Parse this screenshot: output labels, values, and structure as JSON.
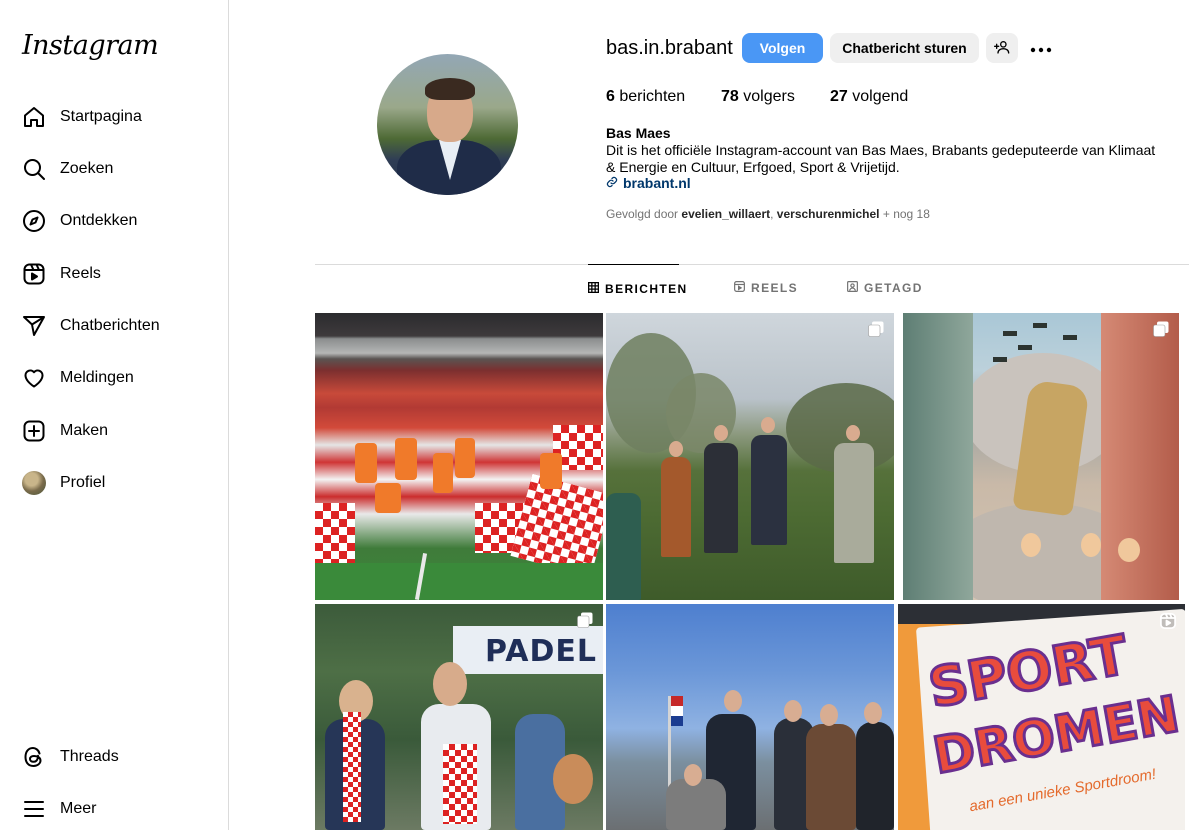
{
  "app": {
    "logo": "Instagram"
  },
  "sidebar": {
    "items": [
      {
        "label": "Startpagina",
        "icon": "home-icon"
      },
      {
        "label": "Zoeken",
        "icon": "search-icon"
      },
      {
        "label": "Ontdekken",
        "icon": "compass-icon"
      },
      {
        "label": "Reels",
        "icon": "reels-icon"
      },
      {
        "label": "Chatberichten",
        "icon": "messenger-icon"
      },
      {
        "label": "Meldingen",
        "icon": "heart-icon"
      },
      {
        "label": "Maken",
        "icon": "plus-square-icon"
      },
      {
        "label": "Profiel",
        "icon": "avatar"
      }
    ],
    "bottom": [
      {
        "label": "Threads",
        "icon": "threads-icon"
      },
      {
        "label": "Meer",
        "icon": "menu-icon"
      }
    ]
  },
  "profile": {
    "username": "bas.in.brabant",
    "follow_label": "Volgen",
    "message_label": "Chatbericht sturen",
    "stats": {
      "posts_count": "6",
      "posts_label": "berichten",
      "followers_count": "78",
      "followers_label": "volgers",
      "following_count": "27",
      "following_label": "volgend"
    },
    "full_name": "Bas Maes",
    "bio": "Dit is het officiële Instagram-account van Bas Maes, Brabants gedeputeerde van Klimaat & Energie en Cultuur, Erfgoed, Sport & Vrijetijd.",
    "link": "brabant.nl",
    "followed_by_prefix": "Gevolgd door",
    "followed_by_user1": "evelien_willaert",
    "followed_by_sep": ",",
    "followed_by_user2": "verschurenmichel",
    "followed_by_suffix": "+ nog 18"
  },
  "tabs": [
    {
      "label": "BERICHTEN",
      "active": true
    },
    {
      "label": "REELS",
      "active": false
    },
    {
      "label": "GETAGD",
      "active": false
    }
  ],
  "posts": {
    "post4_sign": "PADEL",
    "post6_line1": "SPORT",
    "post6_line2": "DROMEN",
    "post6_tagline": "aan een unieke Sportdroom!"
  },
  "colors": {
    "primary_button": "#4a97f5",
    "secondary_button": "#efefef",
    "link": "#00376b",
    "muted_text": "#737373",
    "divider": "#dbdbdb"
  }
}
